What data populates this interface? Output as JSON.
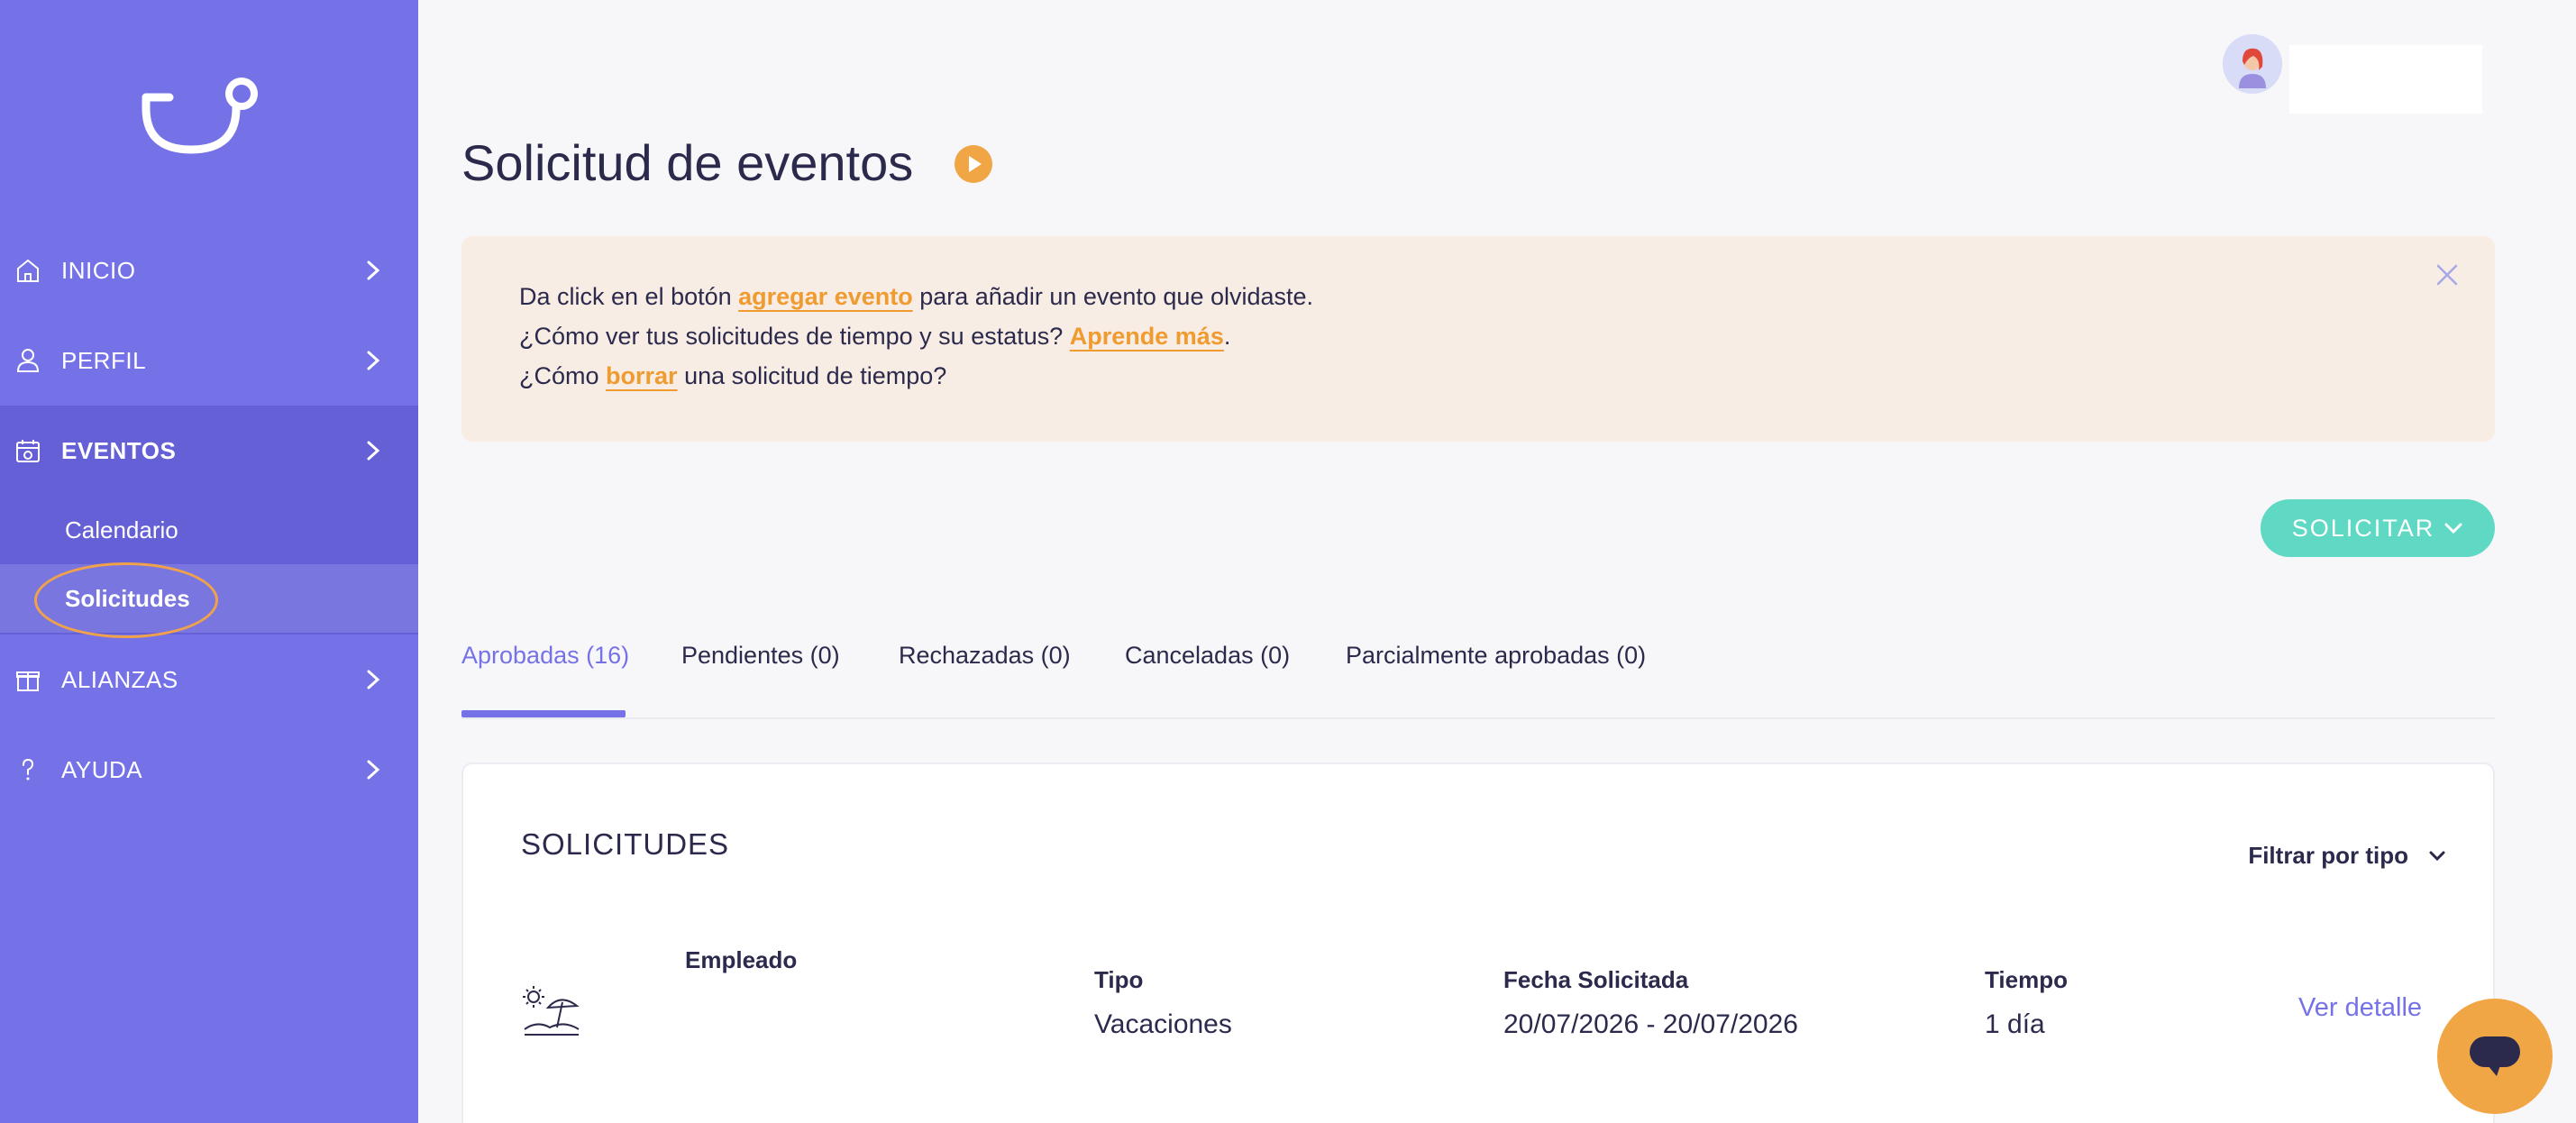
{
  "sidebar": {
    "items": [
      {
        "label": "INICIO"
      },
      {
        "label": "PERFIL"
      },
      {
        "label": "EVENTOS"
      },
      {
        "label": "ALIANZAS"
      },
      {
        "label": "AYUDA"
      }
    ],
    "subitems": [
      {
        "label": "Calendario"
      },
      {
        "label": "Solicitudes"
      }
    ]
  },
  "header": {
    "title": "Solicitud de eventos"
  },
  "banner": {
    "line1_pre": "Da click en el botón ",
    "line1_link": "agregar evento",
    "line1_post": " para añadir un evento que olvidaste.",
    "line2_pre": "¿Cómo ver tus solicitudes de tiempo y su estatus? ",
    "line2_link": "Aprende más",
    "line2_post": ".",
    "line3_pre": "¿Cómo ",
    "line3_link": "borrar",
    "line3_post": " una solicitud de tiempo?"
  },
  "actions": {
    "solicitar_label": "SOLICITAR"
  },
  "tabs": [
    {
      "label": "Aprobadas (16)"
    },
    {
      "label": "Pendientes (0)"
    },
    {
      "label": "Rechazadas (0)"
    },
    {
      "label": "Canceladas (0)"
    },
    {
      "label": "Parcialmente aprobadas (0)"
    }
  ],
  "card": {
    "title": "SOLICITUDES",
    "filter_label": "Filtrar por tipo",
    "columns": {
      "empleado": "Empleado",
      "tipo": "Tipo",
      "fecha": "Fecha Solicitada",
      "tiempo": "Tiempo"
    },
    "row": {
      "tipo": "Vacaciones",
      "fecha": "20/07/2026 - 20/07/2026",
      "tiempo": "1 día",
      "action": "Ver detalle"
    }
  },
  "colors": {
    "sidebar": "#7572e8",
    "accent_orange": "#ef9b30",
    "accent_teal": "#5fd9c3",
    "banner_bg": "#f8ede4"
  },
  "icons": {
    "inicio": "home-icon",
    "perfil": "user-icon",
    "eventos": "calendar-icon",
    "alianzas": "gift-icon",
    "ayuda": "question-icon"
  }
}
